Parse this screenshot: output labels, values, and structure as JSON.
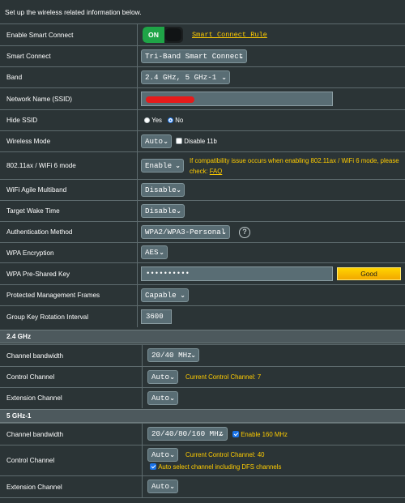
{
  "intro": "Set up the wireless related information below.",
  "smart_connect_enable": {
    "label": "Enable Smart Connect",
    "toggle": "ON",
    "rule_link": "Smart Connect Rule"
  },
  "smart_connect": {
    "label": "Smart Connect",
    "value": "Tri-Band Smart Connect"
  },
  "band": {
    "label": "Band",
    "value": "2.4 GHz, 5 GHz-1"
  },
  "ssid": {
    "label": "Network Name (SSID)",
    "value": ""
  },
  "hide_ssid": {
    "label": "Hide SSID",
    "yes": "Yes",
    "no": "No",
    "selected": "No"
  },
  "wireless_mode": {
    "label": "Wireless Mode",
    "value": "Auto",
    "disable_11b": "Disable 11b"
  },
  "wifi6": {
    "label": "802.11ax / WiFi 6 mode",
    "value": "Enable",
    "note": "If compatibility issue occurs when enabling 802.11ax / WiFi 6 mode, please check:",
    "faq": "FAQ"
  },
  "agile": {
    "label": "WiFi Agile Multiband",
    "value": "Disable"
  },
  "twt": {
    "label": "Target Wake Time",
    "value": "Disable"
  },
  "auth": {
    "label": "Authentication Method",
    "value": "WPA2/WPA3-Personal",
    "help_icon": "help-icon"
  },
  "enc": {
    "label": "WPA Encryption",
    "value": "AES"
  },
  "psk": {
    "label": "WPA Pre-Shared Key",
    "value": "••••••••••",
    "strength": "Good"
  },
  "pmf": {
    "label": "Protected Management Frames",
    "value": "Capable"
  },
  "gkri": {
    "label": "Group Key Rotation Interval",
    "value": "3600"
  },
  "band24": {
    "title": "2.4 GHz",
    "bw": {
      "label": "Channel bandwidth",
      "value": "20/40 MHz"
    },
    "ctrl": {
      "label": "Control Channel",
      "value": "Auto",
      "current": "Current Control Channel: 7"
    },
    "ext": {
      "label": "Extension Channel",
      "value": "Auto"
    }
  },
  "band5": {
    "title": "5 GHz-1",
    "bw": {
      "label": "Channel bandwidth",
      "value": "20/40/80/160 MHz",
      "enable160": "Enable 160 MHz"
    },
    "ctrl": {
      "label": "Control Channel",
      "value": "Auto",
      "current": "Current Control Channel: 40",
      "dfs": "Auto select channel including DFS channels"
    },
    "ext": {
      "label": "Extension Channel",
      "value": "Auto"
    }
  },
  "colors": {
    "background": "#2b3436",
    "accent_yellow": "#ffcc00",
    "toggle_green": "#1fa447",
    "section_bg": "#4d595d"
  }
}
